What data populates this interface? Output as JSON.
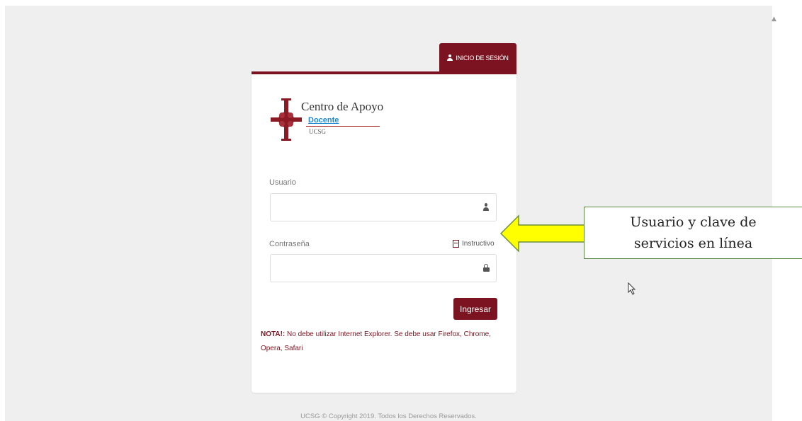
{
  "login_tab": {
    "label": "INICIO DE SESIÓN",
    "icon": "user-icon"
  },
  "logo": {
    "title": "Centro de Apoyo",
    "subtitle": "Docente",
    "org": "UCSG"
  },
  "form": {
    "username_label": "Usuario",
    "username_value": "",
    "password_label": "Contraseña",
    "password_value": "",
    "instructivo_label": "Instructivo",
    "submit_label": "Ingresar"
  },
  "note": {
    "prefix": "NOTA!:",
    "text": " No debe utilizar Internet Explorer. Se debe usar Firefox, Chrome, Opera, Safari"
  },
  "footer": "UCSG © Copyright 2019. Todos los Derechos Reservados.",
  "callout": {
    "line1": "Usuario y clave de",
    "line2": "servicios en línea"
  },
  "colors": {
    "brand": "#7b1420",
    "callout_arrow": "#ffff00",
    "callout_border": "#5c8a46"
  }
}
